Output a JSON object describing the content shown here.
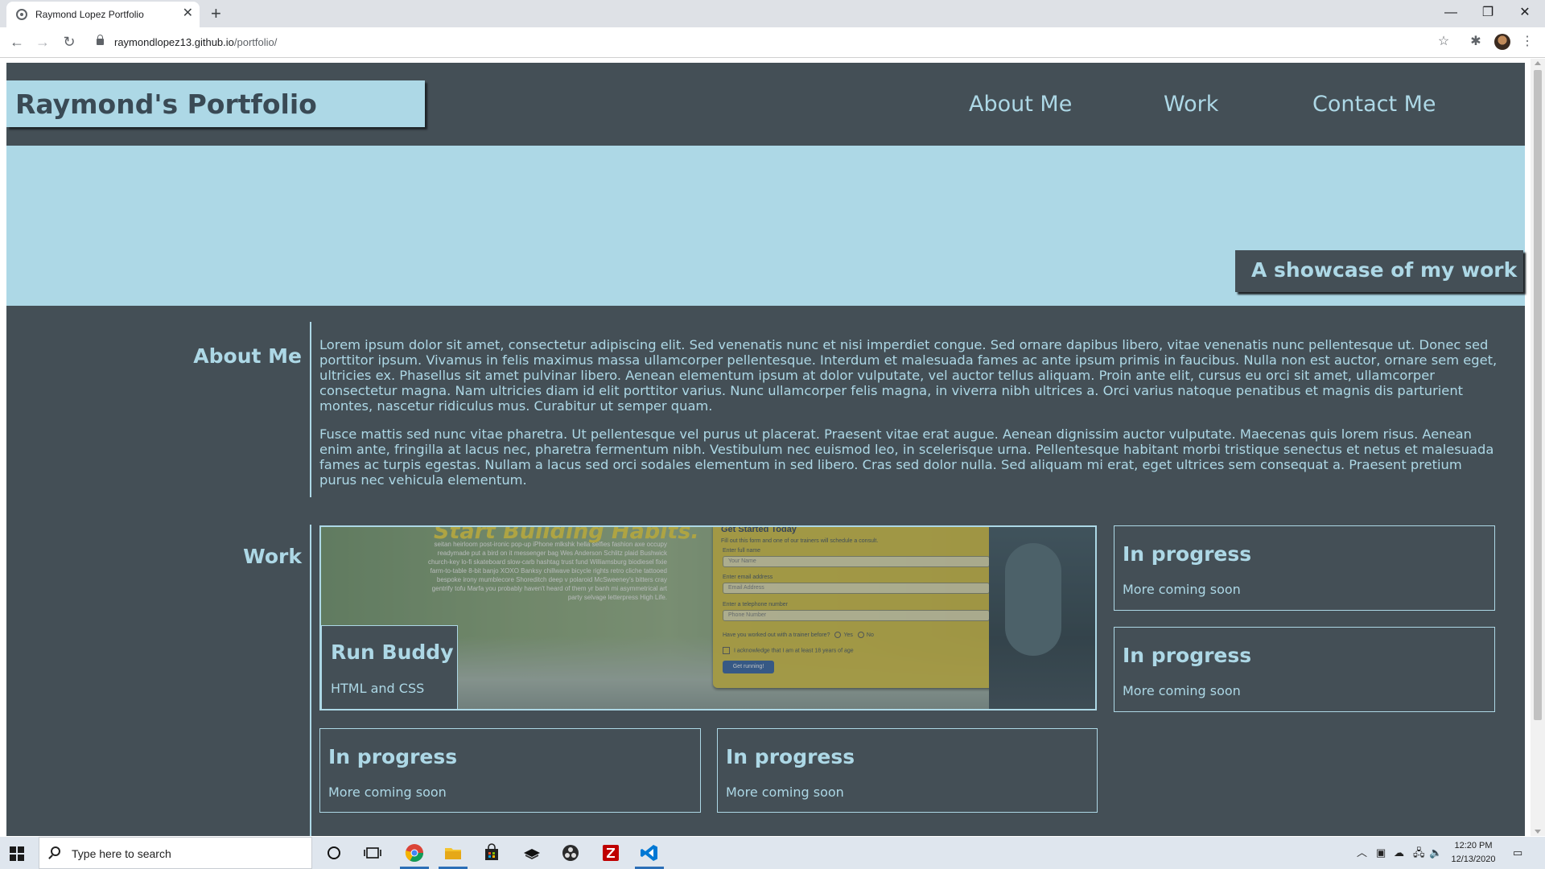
{
  "browser": {
    "tab_title": "Raymond Lopez Portfolio",
    "tab_close": "✕",
    "new_tab": "+",
    "url_host": "raymondlopez13.github.io",
    "url_path": "/portfolio/",
    "window_controls": {
      "minimize": "—",
      "restore": "❐",
      "close": "✕"
    },
    "nav": {
      "back": "←",
      "forward": "→",
      "reload": "↻"
    },
    "toolbar_icons": {
      "bookmark": "☆",
      "extensions": "✱",
      "menu": "⋮"
    }
  },
  "site": {
    "logo": "Raymond's Portfolio",
    "nav": [
      {
        "label": "About Me"
      },
      {
        "label": "Work"
      },
      {
        "label": "Contact Me"
      }
    ],
    "hero_tagline": "A showcase of my work"
  },
  "about": {
    "heading": "About Me",
    "paragraphs": [
      "Lorem ipsum dolor sit amet, consectetur adipiscing elit. Sed venenatis nunc et nisi imperdiet congue. Sed ornare dapibus libero, vitae venenatis nunc pellentesque ut. Donec sed porttitor ipsum. Vivamus in felis maximus massa ullamcorper pellentesque. Interdum et malesuada fames ac ante ipsum primis in faucibus. Nulla non est auctor, ornare sem eget, ultricies ex. Phasellus sit amet pulvinar libero. Aenean elementum ipsum at dolor vulputate, vel auctor tellus aliquam. Proin ante elit, cursus eu orci sit amet, ullamcorper consectetur magna. Nam ultricies diam id elit porttitor varius. Nunc ullamcorper felis magna, in viverra nibh ultrices a. Orci varius natoque penatibus et magnis dis parturient montes, nascetur ridiculus mus. Curabitur ut semper quam.",
      "Fusce mattis sed nunc vitae pharetra. Ut pellentesque vel purus ut placerat. Praesent vitae erat augue. Aenean dignissim auctor vulputate. Maecenas quis lorem risus. Aenean enim ante, fringilla at lacus nec, pharetra fermentum nibh. Vestibulum nec euismod leo, in scelerisque urna. Pellentesque habitant morbi tristique senectus et netus et malesuada fames ac turpis egestas. Nullam a lacus sed orci sodales elementum in sed libero. Cras sed dolor nulla. Sed aliquam mi erat, eget ultrices sem consequat a. Praesent pretium purus nec vehicula elementum."
    ]
  },
  "work": {
    "heading": "Work",
    "featured": {
      "title": "Run Buddy",
      "subtitle": "HTML and CSS",
      "screenshot": {
        "headline": "Start Building Habits.",
        "blurb": "seitan heirloom post-ironic pop-up iPhone mlkshk hella selfies fashion axe occupy readymade put a bird on it messenger bag Wes Anderson Schlitz plaid Bushwick church-key lo-fi skateboard slow-carb hashtag trust fund Williamsburg biodiesel fixie farm-to-table 8-bit banjo XOXO Banksy chillwave bicycle rights retro cliche tattooed bespoke irony mumblecore Shoreditch deep v polaroid McSweeney's bitters cray gentrify tofu Marfa you probably haven't heard of them yr banh mi asymmetrical art party selvage letterpress High Life.",
        "form_title": "Get Started Today",
        "form_subtitle": "Fill out this form and one of our trainers will schedule a consult.",
        "label_name": "Enter full name",
        "placeholder_name": "Your Name",
        "label_email": "Enter email address",
        "placeholder_email": "Email Address",
        "label_phone": "Enter a telephone number",
        "placeholder_phone": "Phone Number",
        "radio_question": "Have you worked out with a trainer before?",
        "radio_yes": "Yes",
        "radio_no": "No",
        "checkbox_label": "I acknowledge that I am at least 18 years of age",
        "button": "Get running!"
      }
    },
    "cards": [
      {
        "title": "In progress",
        "subtitle": "More coming soon"
      },
      {
        "title": "In progress",
        "subtitle": "More coming soon"
      },
      {
        "title": "In progress",
        "subtitle": "More coming soon"
      },
      {
        "title": "In progress",
        "subtitle": "More coming soon"
      }
    ]
  },
  "taskbar": {
    "search_placeholder": "Type here to search",
    "time": "12:20 PM",
    "date": "12/13/2020",
    "apps": [
      "cortana",
      "task-view",
      "chrome",
      "file-explorer",
      "store",
      "app-black",
      "obs",
      "filezilla",
      "vscode"
    ]
  },
  "colors": {
    "site_dark": "#444f56",
    "site_light": "#add8e6",
    "logo_text": "#3a4a55"
  }
}
